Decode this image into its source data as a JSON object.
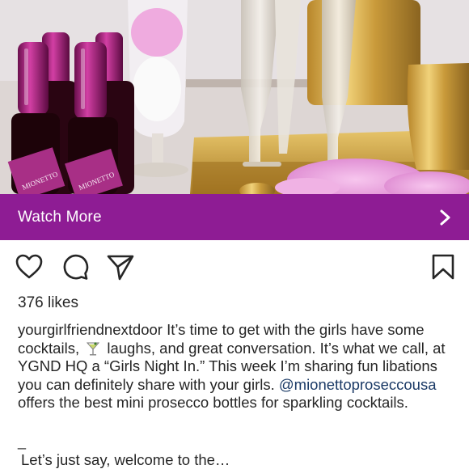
{
  "media": {
    "description_icon": "photo-image",
    "bottle_label_text": "MIONETTO"
  },
  "cta": {
    "label": "Watch More",
    "icon": "chevron-right-icon",
    "color": "#8e1c94"
  },
  "actions": {
    "like_icon": "heart-icon",
    "comment_icon": "comment-icon",
    "share_icon": "paper-plane-icon",
    "save_icon": "bookmark-icon"
  },
  "post": {
    "likes": "376 likes",
    "username": "yourgirlfriendnextdoor",
    "caption_part1": " It’s time to get with the girls have some cocktails, ",
    "caption_emoji": "cocktail-glass-icon",
    "caption_part2": " laughs, and great conversation. It’s what we call, at YGND HQ  a “Girls Night In.” This week I’m sharing fun libations you can definitely share with your girls. ",
    "mention": "@mionettoproseccousa",
    "caption_part3": " offers the best mini prosecco bottles for sparkling  cocktails.",
    "separator": "_",
    "more_text": "Let’s just say, welcome to the…"
  }
}
